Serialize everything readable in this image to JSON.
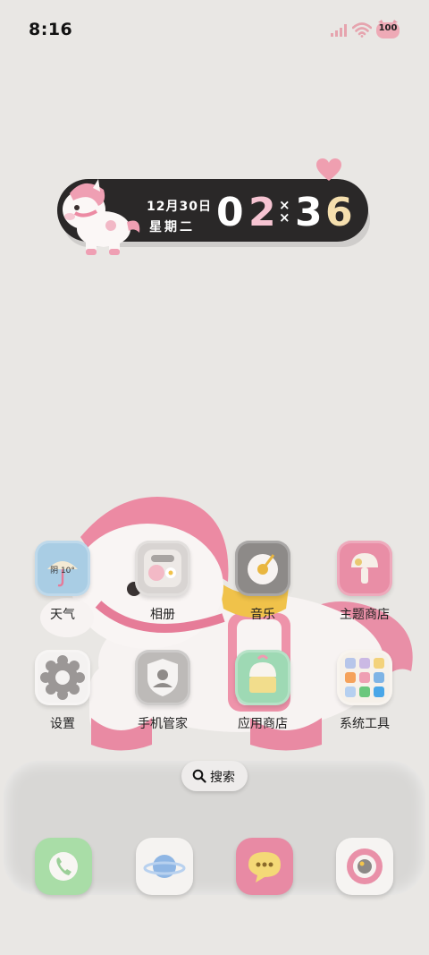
{
  "status_bar": {
    "time": "8:16",
    "battery": "100",
    "accent": "#e79aa8"
  },
  "clock_widget": {
    "date": "12月30日",
    "weekday": "星期二",
    "hour_1": "0",
    "hour_2": "2",
    "minute_1": "3",
    "minute_2": "6",
    "colors": {
      "white": "#ffffff",
      "pink": "#f6c4d2",
      "cream": "#f5dfae"
    }
  },
  "weather_icon_text": "阴 10°",
  "apps": [
    {
      "label": "天气",
      "icon": "weather-umbrella-icon"
    },
    {
      "label": "相册",
      "icon": "gallery-icon"
    },
    {
      "label": "音乐",
      "icon": "music-icon"
    },
    {
      "label": "主题商店",
      "icon": "theme-store-icon"
    },
    {
      "label": "设置",
      "icon": "settings-gear-icon"
    },
    {
      "label": "手机管家",
      "icon": "phone-manager-shield-icon"
    },
    {
      "label": "应用商店",
      "icon": "app-store-icon"
    },
    {
      "label": "系统工具",
      "icon": "system-tools-folder-icon"
    }
  ],
  "search": {
    "label": "搜索"
  },
  "dock": [
    {
      "icon": "phone-icon"
    },
    {
      "icon": "browser-planet-icon"
    },
    {
      "icon": "messages-icon"
    },
    {
      "icon": "camera-icon"
    }
  ]
}
